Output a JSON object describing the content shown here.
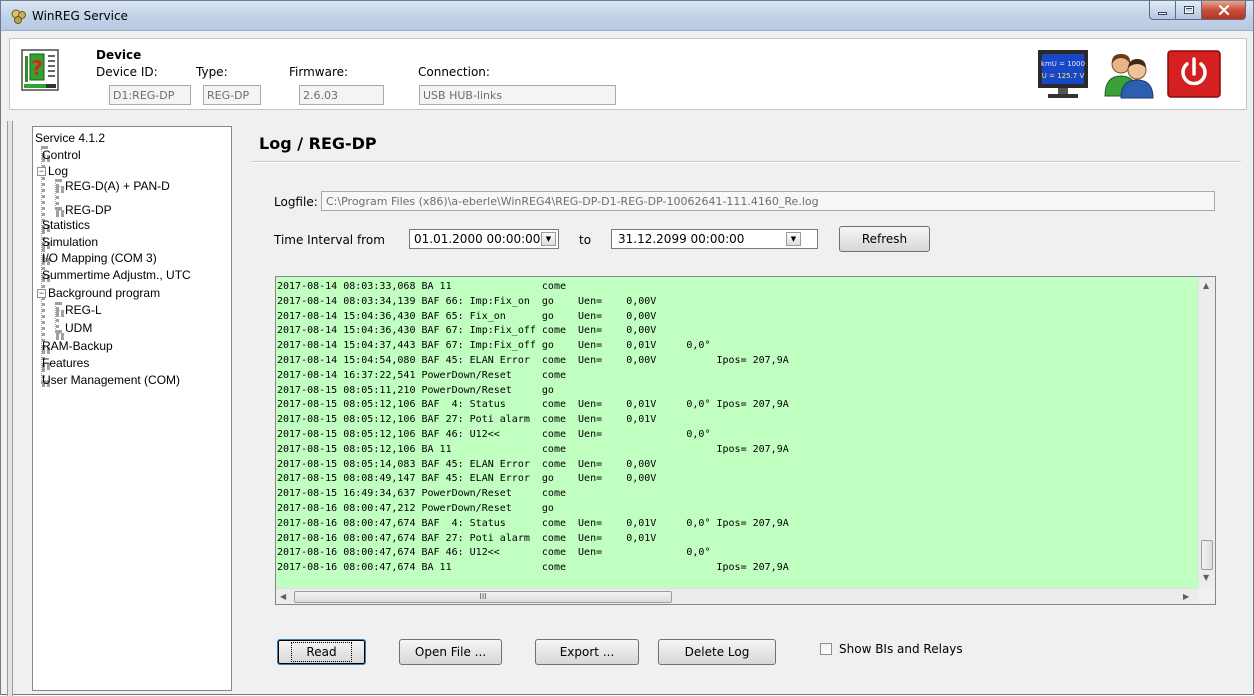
{
  "window": {
    "title": "WinREG Service"
  },
  "device": {
    "heading": "Device",
    "id_label": "Device ID:",
    "type_label": "Type:",
    "firmware_label": "Firmware:",
    "connection_label": "Connection:",
    "id_value": "D1:REG-DP",
    "type_value": "REG-DP",
    "firmware_value": "2.6.03",
    "connection_value": "USB HUB-links",
    "monitor_line1": "kmU = 1000",
    "monitor_line2": "U = 125.7 V"
  },
  "tree": {
    "root": "Service 4.1.2",
    "control": "Control",
    "log": "Log",
    "log_regd": "REG-D(A) + PAN-D",
    "log_regdp": "REG-DP",
    "statistics": "Statistics",
    "simulation": "Simulation",
    "io_mapping": "I/O Mapping (COM 3)",
    "summertime": "Summertime Adjustm., UTC",
    "background": "Background program",
    "bg_regl": "REG-L",
    "bg_udm": "UDM",
    "ram_backup": "RAM-Backup",
    "features": "Features",
    "user_mgmt": "User Management (COM)"
  },
  "main": {
    "title": "Log / REG-DP",
    "logfile_label": "Logfile:",
    "logfile_path": "C:\\Program Files (x86)\\a-eberle\\WinREG4\\REG-DP-D1-REG-DP-10062641-111.4160_Re.log",
    "time_from_label": "Time Interval from",
    "time_from": "01.01.2000  00:00:00",
    "to_label": "to",
    "time_to": "31.12.2099  00:00:00",
    "refresh": "Refresh",
    "read": "Read",
    "open_file": "Open File ...",
    "export": "Export ...",
    "delete_log": "Delete Log",
    "show_bis": "Show BIs and Relays",
    "hscroll_grip": "III"
  },
  "log_lines": [
    "2017-08-14 08:03:33,068 BA 11               come",
    "2017-08-14 08:03:34,139 BAF 66: Imp:Fix_on  go    Uen=    0,00V",
    "2017-08-14 15:04:36,430 BAF 65: Fix_on      go    Uen=    0,00V",
    "2017-08-14 15:04:36,430 BAF 67: Imp:Fix_off come  Uen=    0,00V",
    "2017-08-14 15:04:37,443 BAF 67: Imp:Fix_off go    Uen=    0,01V     0,0°",
    "2017-08-14 15:04:54,080 BAF 45: ELAN Error  come  Uen=    0,00V          Ipos= 207,9A",
    "2017-08-14 16:37:22,541 PowerDown/Reset     come",
    "2017-08-15 08:05:11,210 PowerDown/Reset     go",
    "2017-08-15 08:05:12,106 BAF  4: Status      come  Uen=    0,01V     0,0° Ipos= 207,9A",
    "2017-08-15 08:05:12,106 BAF 27: Poti alarm  come  Uen=    0,01V",
    "2017-08-15 08:05:12,106 BAF 46: U12<<       come  Uen=              0,0°",
    "2017-08-15 08:05:12,106 BA 11               come                         Ipos= 207,9A",
    "2017-08-15 08:05:14,083 BAF 45: ELAN Error  come  Uen=    0,00V",
    "2017-08-15 08:08:49,147 BAF 45: ELAN Error  go    Uen=    0,00V",
    "2017-08-15 16:49:34,637 PowerDown/Reset     come",
    "2017-08-16 08:00:47,212 PowerDown/Reset     go",
    "2017-08-16 08:00:47,674 BAF  4: Status      come  Uen=    0,01V     0,0° Ipos= 207,9A",
    "2017-08-16 08:00:47,674 BAF 27: Poti alarm  come  Uen=    0,01V",
    "2017-08-16 08:00:47,674 BAF 46: U12<<       come  Uen=              0,0°",
    "2017-08-16 08:00:47,674 BA 11               come                         Ipos= 207,9A"
  ],
  "icons": {
    "app": "gear-cluster-icon",
    "device": "device-question-icon",
    "monitor": "monitor-icon",
    "users": "users-icon",
    "power": "power-icon"
  },
  "colors": {
    "log_background": "#c0ffc0",
    "power_button": "#d42020"
  }
}
